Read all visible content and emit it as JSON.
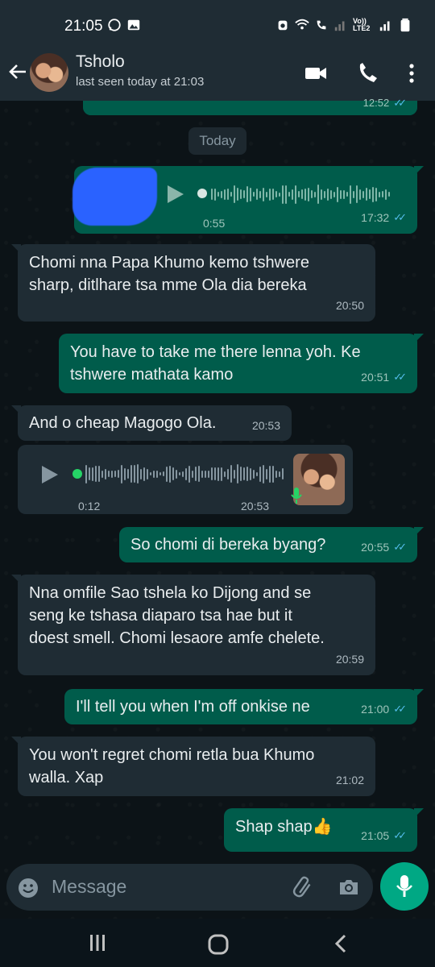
{
  "status_bar": {
    "time": "21:05",
    "net_label": "Vo)) LTE2"
  },
  "header": {
    "name": "Tsholo",
    "last_seen": "last seen today at 21:03"
  },
  "date_chip": "Today",
  "messages": [
    {
      "dir": "out",
      "partial": true,
      "time": "12:52"
    },
    {
      "dir": "out",
      "type": "voice",
      "duration": "0:55",
      "time": "17:32"
    },
    {
      "dir": "in",
      "text_lines": [
        "Chomi nna Papa Khumo kemo tshwere",
        "sharp, ditlhare tsa mme Ola dia bereka"
      ],
      "time": "20:50"
    },
    {
      "dir": "out",
      "text_lines": [
        "You have to take me there lenna yoh. Ke",
        "tshwere mathata kamo"
      ],
      "time": "20:51"
    },
    {
      "dir": "in",
      "text_lines": [
        "And o cheap Magogo Ola."
      ],
      "time": "20:53"
    },
    {
      "dir": "in",
      "type": "voice",
      "duration": "0:12",
      "time": "20:53"
    },
    {
      "dir": "out",
      "text_lines": [
        "So chomi di bereka byang?"
      ],
      "time": "20:55"
    },
    {
      "dir": "in",
      "text_lines": [
        "Nna omfile Sao tshela ko Dijong  and se",
        "seng ke tshasa diaparo tsa hae but it",
        "doest smell. Chomi lesaore amfe chelete."
      ],
      "time": "20:59"
    },
    {
      "dir": "out",
      "text_lines": [
        "I'll tell you when I'm off onkise ne"
      ],
      "time": "21:00"
    },
    {
      "dir": "in",
      "text_lines": [
        "You won't regret chomi retla bua Khumo",
        "walla. Xap"
      ],
      "time": "21:02"
    },
    {
      "dir": "out",
      "text_lines": [
        "Shap shap👍"
      ],
      "time": "21:05"
    }
  ],
  "input": {
    "placeholder": "Message"
  },
  "colors": {
    "incoming": "#1f2c34",
    "outgoing": "#005c4b",
    "accent": "#00a884",
    "read_ticks": "#53bdeb"
  },
  "icons": [
    "whatsapp-icon",
    "gallery-icon",
    "alarm-icon",
    "wifi-icon",
    "signal-icon",
    "battery-icon",
    "back-arrow-icon",
    "video-call-icon",
    "phone-icon",
    "more-icon",
    "play-icon",
    "emoji-icon",
    "attach-icon",
    "camera-icon",
    "mic-icon",
    "recents-icon",
    "home-icon",
    "back-icon"
  ]
}
